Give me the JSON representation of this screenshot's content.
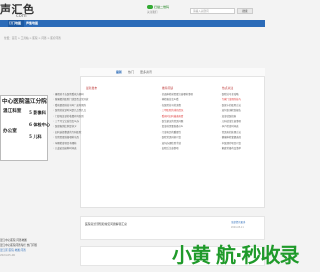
{
  "header": {
    "logo": "声汇色",
    "logo_sub": "com",
    "wechat_label": "扫描二维码",
    "wechat_sub": "关注我们",
    "search_placeholder": "请输入关键词",
    "search_button": "搜索"
  },
  "nav": {
    "items": [
      {
        "label": "订门地图",
        "active": true
      },
      {
        "label": "声售地图",
        "active": false
      }
    ]
  },
  "breadcrumb": "位置：首页 > 工具站 > 医院 > 问答 > 医疗问答",
  "tabs": [
    "最新",
    "热门",
    "更多资讯"
  ],
  "columns": [
    {
      "header": "最新发布",
      "items": [
        "暑假孩子去医院看病方便吗",
        "寒暑假的医院门诊是否正常开放",
        "看病要提前挂号吗？如何预约",
        "医院的就诊时间是几点到几点",
        "门诊和急诊的收费有何区别",
        "三个月宝宝发烧怎么办",
        "医保报销比例是多少",
        "如何选择靠谱的专科医院",
        "住院需要准备哪些东西",
        "孕期检查项目有哪些",
        "儿童疫苗接种时间表"
      ]
    },
    {
      "header": "推荐阅读",
      "items": [
        "全面体检前需要注意哪些事项",
        "体检报告怎么看",
        "在医院挂号的流程",
        "三甲医院的排名情况",
        "看病时如何描述病情",
        "医生建议的常见问题",
        "复诊前需要准备什么",
        "门诊病历的重要性",
        "医院常见科室介绍",
        "如何办理住院手续",
        "出院后注意事项"
      ]
    },
    {
      "header": "热点关注",
      "items": [
        "医院挂号全攻略",
        "专家门诊预约技巧",
        "医保卡的使用方法",
        "如何查询检查报告",
        "急诊就医指南",
        "儿科就诊注意事项",
        "孕产检查时间表",
        "常见病的处理方法",
        "健康体检套餐选择",
        "中医理疗项目介绍",
        "家庭常备药品清单"
      ]
    }
  ],
  "redbox": {
    "title": "中心医院温江分院",
    "rows": [
      "温江科室",
      "办公室"
    ],
    "side": [
      "5 影像科",
      "6 体检中心",
      "5 儿科"
    ]
  },
  "more": {
    "title": "医院就诊须知和常见问题解答汇总",
    "right": "全部资讯更多",
    "date": "2024-05-11"
  },
  "bottom": {
    "lines": [
      "温江中心医院 问答地图",
      "温江中心医院问答专栏 热门问答"
    ],
    "link": "温江区 医院 地图 问答",
    "date": "2024-05-06"
  },
  "watermark": "小黄 航·秒收录"
}
